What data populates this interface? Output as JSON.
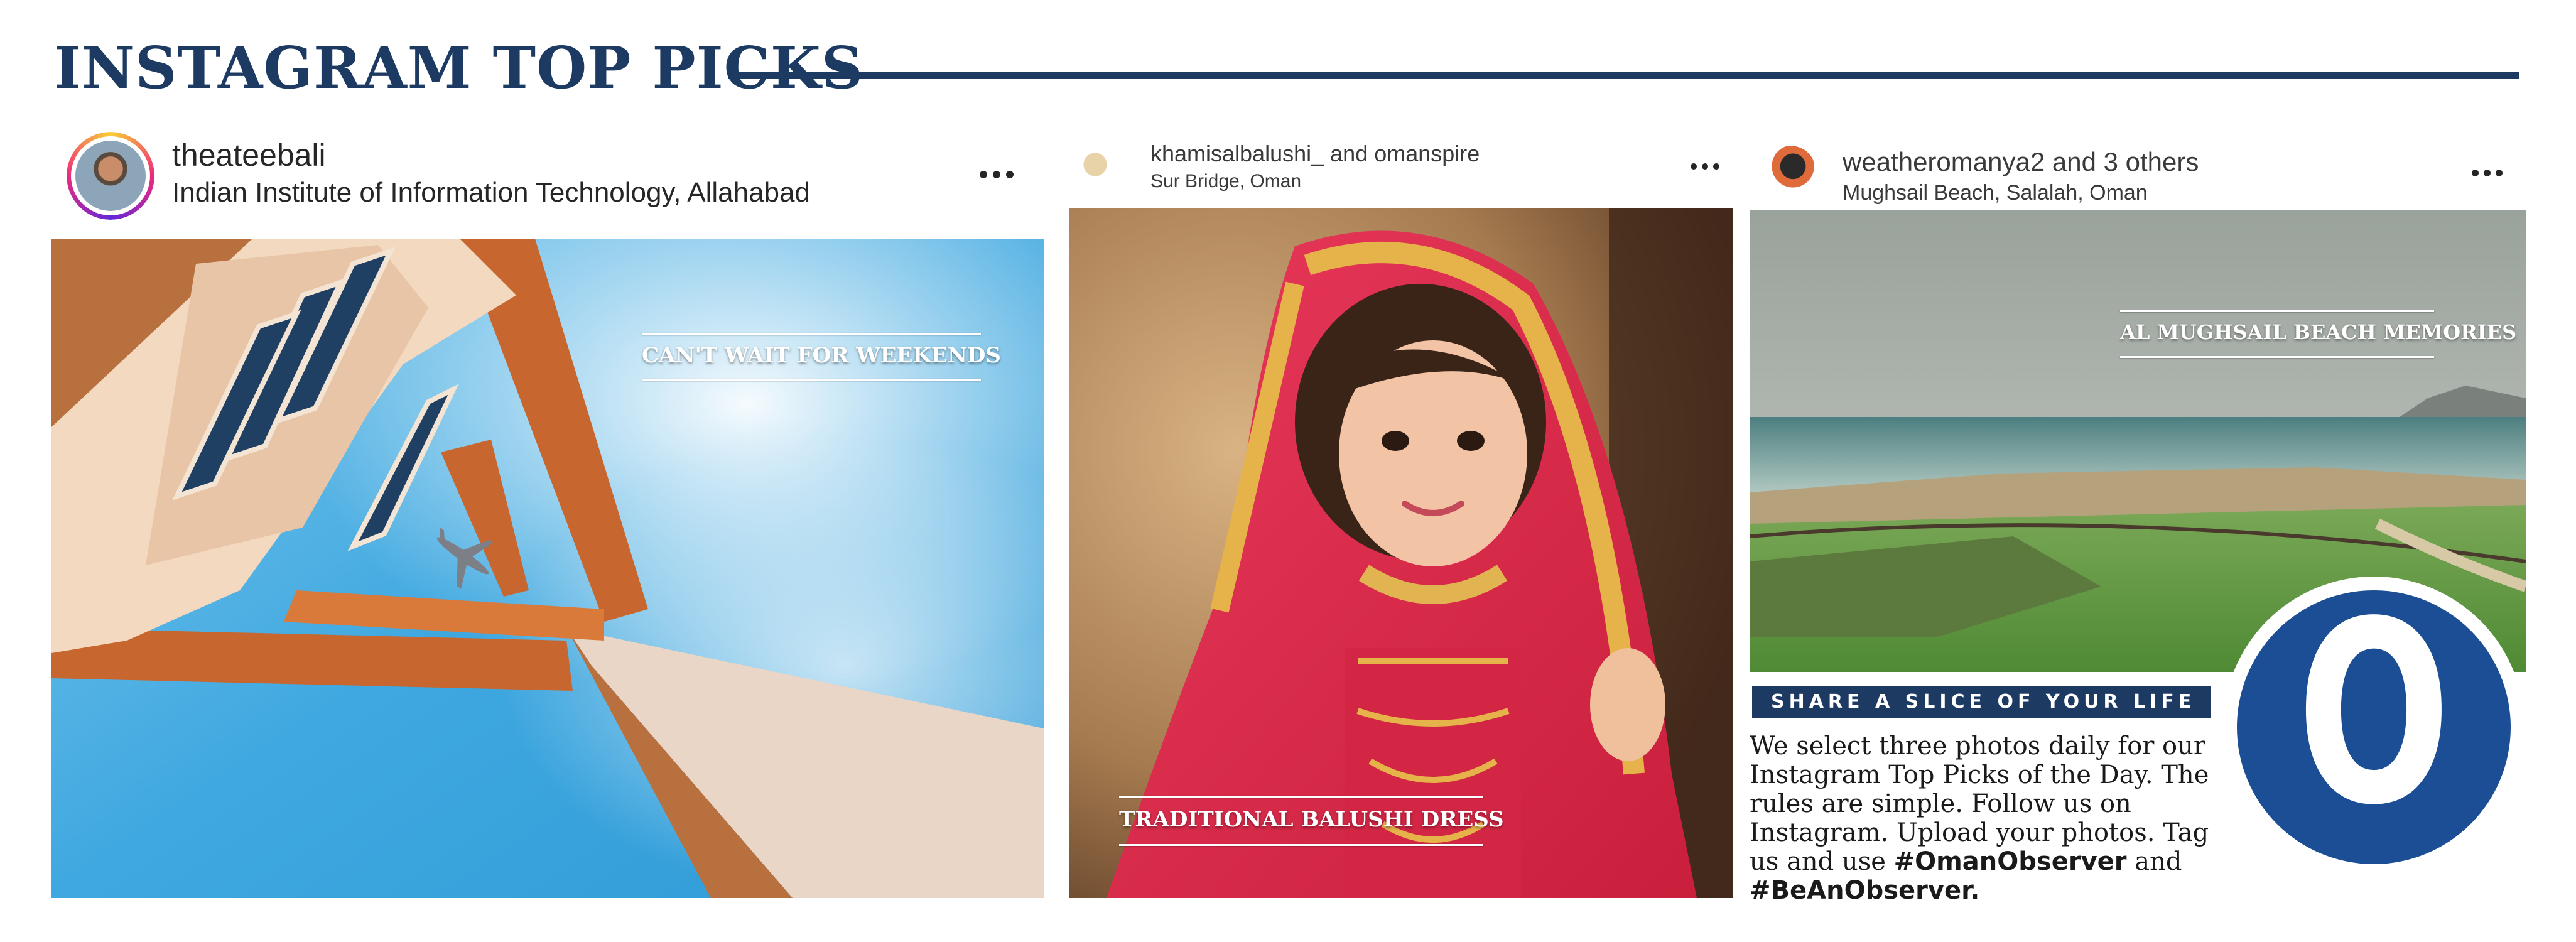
{
  "header": {
    "title": "INSTAGRAM TOP PICKS"
  },
  "posts": [
    {
      "username": "theateebali",
      "location": "Indian Institute of Information Technology, Allahabad",
      "caption": "CAN'T WAIT FOR WEEKENDS"
    },
    {
      "username": "khamisalbalushi_ and omanspire",
      "location": "Sur Bridge, Oman",
      "caption": "TRADITIONAL BALUSHI DRESS"
    },
    {
      "username": "weatheromanya2 and 3 others",
      "location": "Mughsail Beach, Salalah, Oman",
      "caption": "AL MUGHSAIL BEACH MEMORIES"
    }
  ],
  "share": {
    "banner": "SHARE A SLICE OF YOUR LIFE",
    "text_1": "We select three photos daily for our Instagram Top Picks of the Day. The rules are simple. Follow us on Instagram. Upload your photos. Tag us and use ",
    "hashtag_1": "#OmanObserver",
    "text_2": " and ",
    "hashtag_2": "#BeAnObserver."
  },
  "logo": {
    "letter": "O"
  },
  "icons": [
    "more-options-icon",
    "avatar-icon",
    "airplane-icon"
  ],
  "colors": {
    "brand_navy": "#1d3a63",
    "logo_blue": "#1b4e94"
  }
}
